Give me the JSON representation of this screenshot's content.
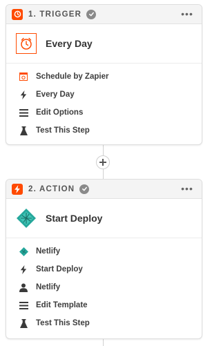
{
  "trigger": {
    "step_title": "1. TRIGGER",
    "more_label": "•••",
    "app_title": "Every Day",
    "items": [
      {
        "label": "Schedule by Zapier",
        "icon": "schedule-icon"
      },
      {
        "label": "Every Day",
        "icon": "lightning-bolt-icon"
      },
      {
        "label": "Edit Options",
        "icon": "lines-icon"
      },
      {
        "label": "Test This Step",
        "icon": "flask-icon"
      }
    ]
  },
  "action": {
    "step_title": "2. ACTION",
    "more_label": "•••",
    "app_title": "Start Deploy",
    "items": [
      {
        "label": "Netlify",
        "icon": "netlify-icon"
      },
      {
        "label": "Start Deploy",
        "icon": "lightning-bolt-icon"
      },
      {
        "label": "Netlify",
        "icon": "user-icon"
      },
      {
        "label": "Edit Template",
        "icon": "lines-icon"
      },
      {
        "label": "Test This Step",
        "icon": "flask-icon"
      }
    ]
  },
  "colors": {
    "accent": "#ff4a00",
    "netlify": "#25a79b",
    "check": "#8a8a8a"
  }
}
